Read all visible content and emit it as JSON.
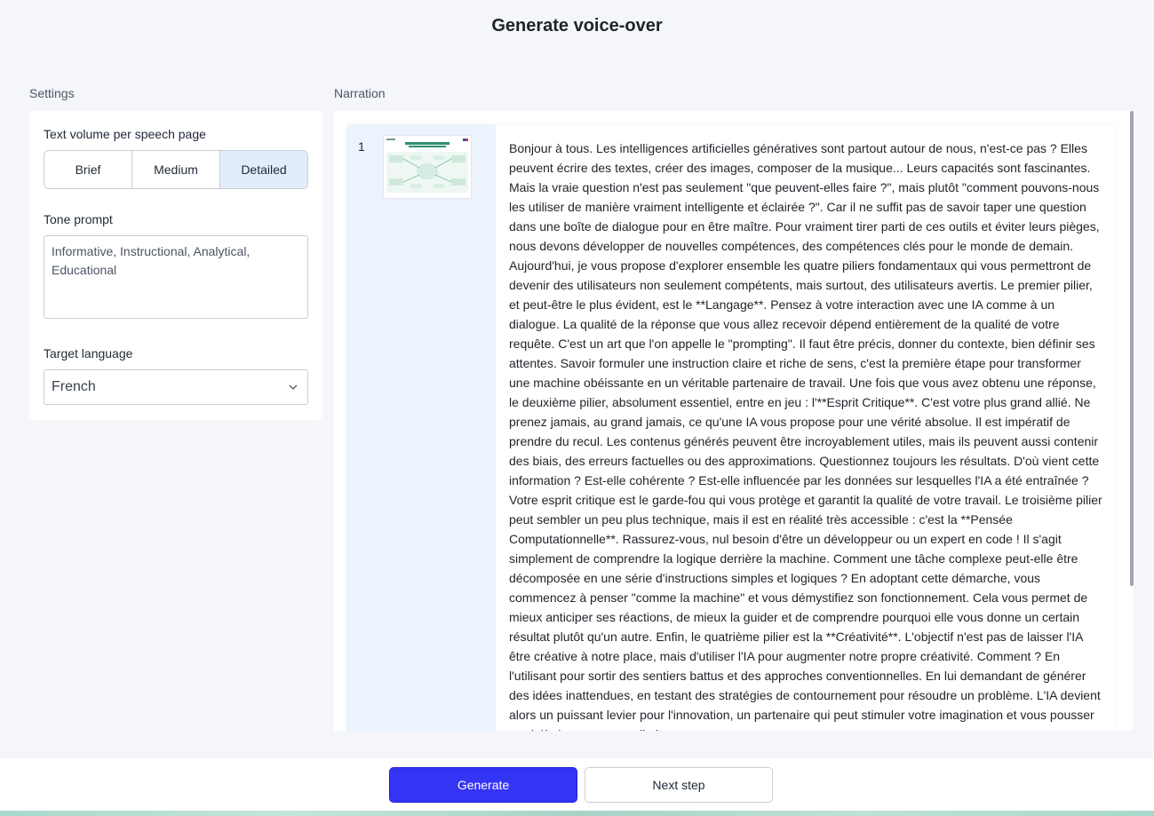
{
  "header": {
    "title": "Generate voice-over"
  },
  "settings": {
    "section_label": "Settings",
    "text_volume": {
      "label": "Text volume per speech page",
      "options": [
        "Brief",
        "Medium",
        "Detailed"
      ],
      "selected": "Detailed"
    },
    "tone": {
      "label": "Tone prompt",
      "value": "Informative, Instructional, Analytical, Educational"
    },
    "language": {
      "label": "Target language",
      "value": "French",
      "icon": "chevron-down-icon"
    }
  },
  "narration": {
    "section_label": "Narration",
    "items": [
      {
        "number": "1",
        "text": "Bonjour à tous. Les intelligences artificielles génératives sont partout autour de nous, n'est-ce pas ? Elles peuvent écrire des textes, créer des images, composer de la musique... Leurs capacités sont fascinantes. Mais la vraie question n'est pas seulement \"que peuvent-elles faire ?\", mais plutôt \"comment pouvons-nous les utiliser de manière vraiment intelligente et éclairée ?\". Car il ne suffit pas de savoir taper une question dans une boîte de dialogue pour en être maître. Pour vraiment tirer parti de ces outils et éviter leurs pièges, nous devons développer de nouvelles compétences, des compétences clés pour le monde de demain. Aujourd'hui, je vous propose d'explorer ensemble les quatre piliers fondamentaux qui vous permettront de devenir des utilisateurs non seulement compétents, mais surtout, des utilisateurs avertis. Le premier pilier, et peut-être le plus évident, est le **Langage**. Pensez à votre interaction avec une IA comme à un dialogue. La qualité de la réponse que vous allez recevoir dépend entièrement de la qualité de votre requête. C'est un art que l'on appelle le \"prompting\". Il faut être précis, donner du contexte, bien définir ses attentes. Savoir formuler une instruction claire et riche de sens, c'est la première étape pour transformer une machine obéissante en un véritable partenaire de travail. Une fois que vous avez obtenu une réponse, le deuxième pilier, absolument essentiel, entre en jeu : l'**Esprit Critique**. C'est votre plus grand allié. Ne prenez jamais, au grand jamais, ce qu'une IA vous propose pour une vérité absolue. Il est impératif de prendre du recul. Les contenus générés peuvent être incroyablement utiles, mais ils peuvent aussi contenir des biais, des erreurs factuelles ou des approximations. Questionnez toujours les résultats. D'où vient cette information ? Est-elle cohérente ? Est-elle influencée par les données sur lesquelles l'IA a été entraînée ? Votre esprit critique est le garde-fou qui vous protège et garantit la qualité de votre travail. Le troisième pilier peut sembler un peu plus technique, mais il est en réalité très accessible : c'est la **Pensée Computationnelle**. Rassurez-vous, nul besoin d'être un développeur ou un expert en code ! Il s'agit simplement de comprendre la logique derrière la machine. Comment une tâche complexe peut-elle être décomposée en une série d'instructions simples et logiques ? En adoptant cette démarche, vous commencez à penser \"comme la machine\" et vous démystifiez son fonctionnement. Cela vous permet de mieux anticiper ses réactions, de mieux la guider et de comprendre pourquoi elle vous donne un certain résultat plutôt qu'un autre. Enfin, le quatrième pilier est la **Créativité**. L'objectif n'est pas de laisser l'IA être créative à notre place, mais d'utiliser l'IA pour augmenter notre propre créativité. Comment ? En l'utilisant pour sortir des sentiers battus et des approches conventionnelles. En lui demandant de générer des idées inattendues, en testant des stratégies de contournement pour résoudre un problème. L'IA devient alors un puissant levier pour l'innovation, un partenaire qui peut stimuler votre imagination et vous pousser au-delà de vos propres limites."
      }
    ]
  },
  "footer": {
    "generate_label": "Generate",
    "next_label": "Next step"
  },
  "colors": {
    "primary": "#3434f5",
    "selected_segment": "#e3ecfb",
    "card_side": "#edf3fc"
  }
}
